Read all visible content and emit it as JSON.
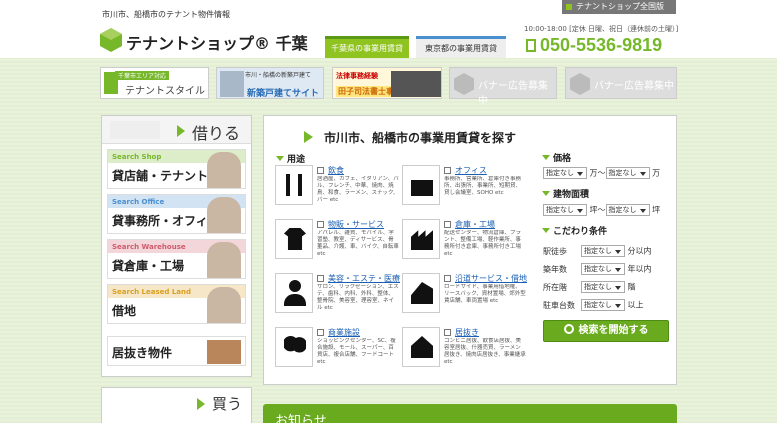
{
  "header": {
    "tagline": "市川市、船橋市のテナント物件情報",
    "zenkoku_link": "テナントショップ全国版",
    "hours": "10:00-18:00 [定休 日曜、祝日（連休前の土曜）]",
    "phone": "050-5536-9819",
    "logo_text": "テナントショップ® 千葉",
    "tabs": [
      {
        "label": "千葉県の事業用賃貸"
      },
      {
        "label": "東京都の事業用賃貸"
      }
    ]
  },
  "banners": [
    {
      "line1": "千葉市エリア対応",
      "line2": "テナントスタイル"
    },
    {
      "line1": "市川・船橋の新築戸建て",
      "line2": "新築戸建てサイト"
    },
    {
      "line1": "法律事務経験",
      "line2": "田子司法書士事務所"
    },
    {
      "label": "バナー広告募集中"
    },
    {
      "label": "バナー広告募集中"
    }
  ],
  "sidebar": {
    "rent_heading": "借りる",
    "items": [
      {
        "en": "Search Shop",
        "jp": "貸店舗・テナント"
      },
      {
        "en": "Search Office",
        "jp": "貸事務所・オフィス"
      },
      {
        "en": "Search Warehouse",
        "jp": "貸倉庫・工場"
      },
      {
        "en": "Search Leased Land",
        "jp": "借地"
      },
      {
        "jp": "居抜き物件"
      }
    ],
    "buy_heading": "買う"
  },
  "search": {
    "title": "市川市、船橋市の事業用賃貸を探す",
    "use_heading": "用途",
    "categories": [
      {
        "name": "飲食",
        "desc": "居酒屋、カフェ、イタリアン、バル、フレンチ、中華、焼肉、焼鳥、和食、ラーメン、スナック、バー etc"
      },
      {
        "name": "オフィス",
        "desc": "事務所、営業所、倉庫付き事務所、出張所、事業所、短期貸、貸し会議室、SOHO etc"
      },
      {
        "name": "物販・サービス",
        "desc": "アパレル、雑貨、モバイル、学習塾、教室、ディサービス、骨董品、介護、車、バイク、自転車 etc"
      },
      {
        "name": "倉庫・工場",
        "desc": "配送センター、物流倉庫、プラント、整備工場、軽作業所、事務所付き倉庫、事務所付き工場 etc"
      },
      {
        "name": "美容・エステ・医療",
        "desc": "サロン、リラクゼーション、エステ、歯科、内科、外科、整体、整骨院、美容室、理容室、ネイル etc"
      },
      {
        "name": "沿道サービス・借地",
        "desc": "ロードサイド、事業用借地権、リースバック、資材置場、郊外型賃店舗、車両置場 etc"
      },
      {
        "name": "商業施設",
        "desc": "ショッピングセンター、SC、複合施設、モール、スーパー、百貨店、複合店舗、フードコート etc"
      },
      {
        "name": "居抜き",
        "desc": "コンビニ居抜、飲食店居抜、美容室居抜、什器売買、ラーメン居抜き、焼肉店居抜き、事業継承 etc"
      }
    ],
    "price_heading": "価格",
    "area_heading": "建物面積",
    "kodawari_heading": "こだわり条件",
    "select_default": "指定なし",
    "price_mid": "万～",
    "price_end": "万",
    "area_mid": "坪～",
    "area_end": "坪",
    "filters": [
      {
        "label": "駅徒歩",
        "suffix": "分以内"
      },
      {
        "label": "築年数",
        "suffix": "年以内"
      },
      {
        "label": "所在階",
        "suffix": "階"
      },
      {
        "label": "駐車台数",
        "suffix": "以上"
      }
    ],
    "go_button": "検索を開始する"
  },
  "news": {
    "heading": "お知らせ"
  }
}
